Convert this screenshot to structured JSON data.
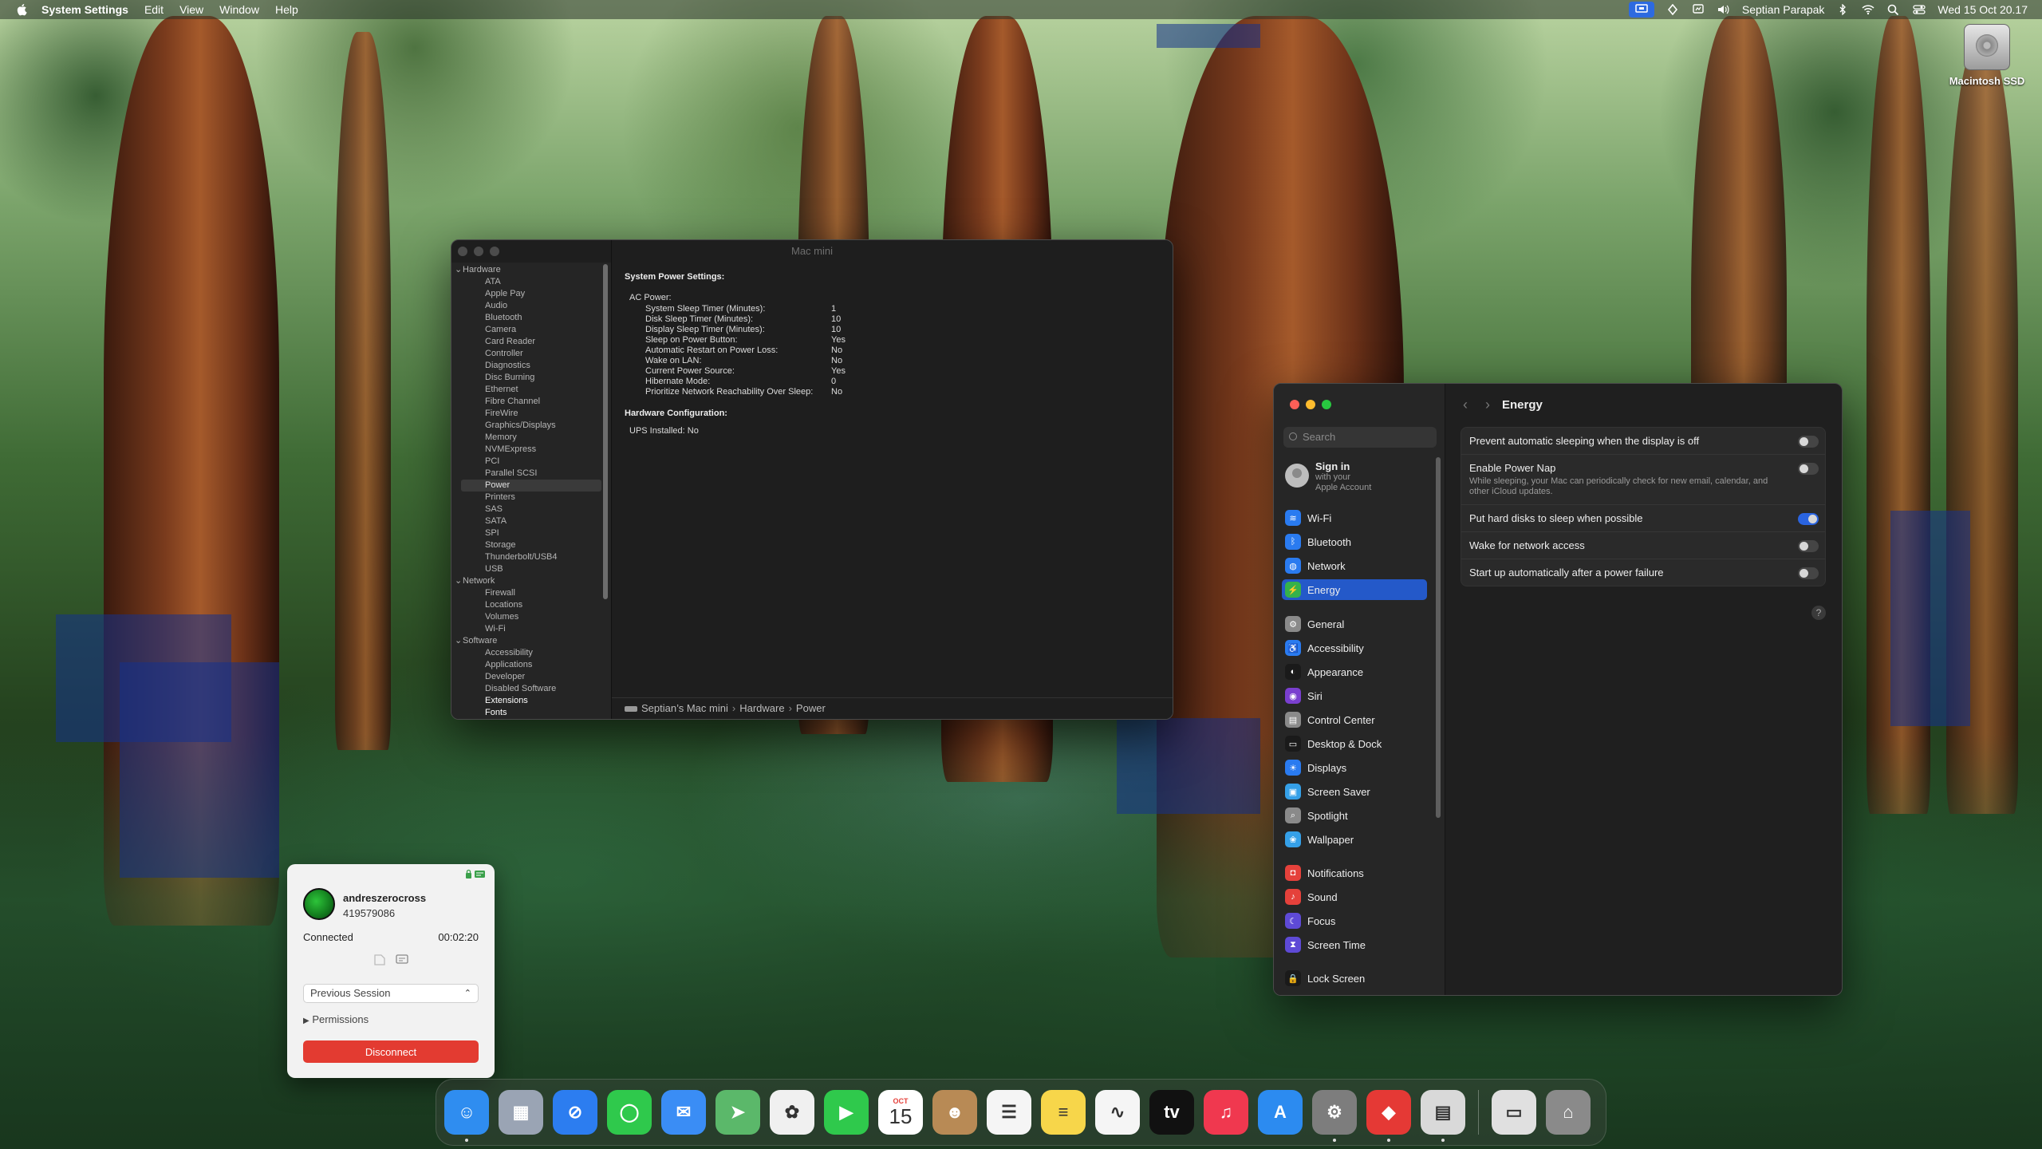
{
  "menubar": {
    "app_name": "System Settings",
    "menus": [
      "Edit",
      "View",
      "Window",
      "Help"
    ],
    "user": "Septian Parapak",
    "clock": "Wed 15 Oct  20.17"
  },
  "desktop": {
    "drive_label": "Macintosh SSD"
  },
  "sysinfo": {
    "title": "Mac mini",
    "sidebar": [
      {
        "label": "Hardware",
        "kind": "group"
      },
      {
        "label": "ATA",
        "kind": "item"
      },
      {
        "label": "Apple Pay",
        "kind": "item"
      },
      {
        "label": "Audio",
        "kind": "item"
      },
      {
        "label": "Bluetooth",
        "kind": "item"
      },
      {
        "label": "Camera",
        "kind": "item"
      },
      {
        "label": "Card Reader",
        "kind": "item"
      },
      {
        "label": "Controller",
        "kind": "item"
      },
      {
        "label": "Diagnostics",
        "kind": "item"
      },
      {
        "label": "Disc Burning",
        "kind": "item"
      },
      {
        "label": "Ethernet",
        "kind": "item"
      },
      {
        "label": "Fibre Channel",
        "kind": "item"
      },
      {
        "label": "FireWire",
        "kind": "item"
      },
      {
        "label": "Graphics/Displays",
        "kind": "item"
      },
      {
        "label": "Memory",
        "kind": "item"
      },
      {
        "label": "NVMExpress",
        "kind": "item"
      },
      {
        "label": "PCI",
        "kind": "item"
      },
      {
        "label": "Parallel SCSI",
        "kind": "item"
      },
      {
        "label": "Power",
        "kind": "item",
        "selected": true
      },
      {
        "label": "Printers",
        "kind": "item"
      },
      {
        "label": "SAS",
        "kind": "item"
      },
      {
        "label": "SATA",
        "kind": "item"
      },
      {
        "label": "SPI",
        "kind": "item"
      },
      {
        "label": "Storage",
        "kind": "item"
      },
      {
        "label": "Thunderbolt/USB4",
        "kind": "item"
      },
      {
        "label": "USB",
        "kind": "item"
      },
      {
        "label": "Network",
        "kind": "group"
      },
      {
        "label": "Firewall",
        "kind": "item"
      },
      {
        "label": "Locations",
        "kind": "item"
      },
      {
        "label": "Volumes",
        "kind": "item"
      },
      {
        "label": "Wi-Fi",
        "kind": "item"
      },
      {
        "label": "Software",
        "kind": "group"
      },
      {
        "label": "Accessibility",
        "kind": "item"
      },
      {
        "label": "Applications",
        "kind": "item"
      },
      {
        "label": "Developer",
        "kind": "item"
      },
      {
        "label": "Disabled Software",
        "kind": "item"
      },
      {
        "label": "Extensions",
        "kind": "item",
        "bold": true
      },
      {
        "label": "Fonts",
        "kind": "item",
        "bold": true
      }
    ],
    "content": {
      "heading": "System Power Settings:",
      "ac_label": "AC Power:",
      "settings": [
        {
          "key": "System Sleep Timer (Minutes):",
          "value": "1"
        },
        {
          "key": "Disk Sleep Timer (Minutes):",
          "value": "10"
        },
        {
          "key": "Display Sleep Timer (Minutes):",
          "value": "10"
        },
        {
          "key": "Sleep on Power Button:",
          "value": "Yes"
        },
        {
          "key": "Automatic Restart on Power Loss:",
          "value": "No"
        },
        {
          "key": "Wake on LAN:",
          "value": "No"
        },
        {
          "key": "Current Power Source:",
          "value": "Yes"
        },
        {
          "key": "Hibernate Mode:",
          "value": "0"
        },
        {
          "key": "Prioritize Network Reachability Over Sleep:",
          "value": "No"
        }
      ],
      "hw_heading": "Hardware Configuration:",
      "ups": "UPS Installed:  No"
    },
    "path": [
      "Septian’s Mac mini",
      "Hardware",
      "Power"
    ]
  },
  "settings": {
    "search_placeholder": "Search",
    "signin_title": "Sign in",
    "signin_sub1": "with your",
    "signin_sub2": "Apple Account",
    "nav": [
      {
        "label": "Wi-Fi",
        "color": "#2a7bf0",
        "glyph": "≋"
      },
      {
        "label": "Bluetooth",
        "color": "#2a7bf0",
        "glyph": "ᛒ"
      },
      {
        "label": "Network",
        "color": "#2a7bf0",
        "glyph": "◍"
      },
      {
        "label": "Energy",
        "color": "#35b14b",
        "glyph": "⚡",
        "selected": true
      },
      {
        "label": "General",
        "color": "#8a8a8a",
        "glyph": "⚙"
      },
      {
        "label": "Accessibility",
        "color": "#2a7bf0",
        "glyph": "♿"
      },
      {
        "label": "Appearance",
        "color": "#1a1a1a",
        "glyph": "◐"
      },
      {
        "label": "Siri",
        "color": "#7a3fcf",
        "glyph": "◉"
      },
      {
        "label": "Control Center",
        "color": "#8a8a8a",
        "glyph": "▤"
      },
      {
        "label": "Desktop & Dock",
        "color": "#1a1a1a",
        "glyph": "▭"
      },
      {
        "label": "Displays",
        "color": "#2a7bf0",
        "glyph": "☀"
      },
      {
        "label": "Screen Saver",
        "color": "#35a0e8",
        "glyph": "▣"
      },
      {
        "label": "Spotlight",
        "color": "#8a8a8a",
        "glyph": "⌕"
      },
      {
        "label": "Wallpaper",
        "color": "#35a0e8",
        "glyph": "❀"
      },
      {
        "label": "Notifications",
        "color": "#e5413b",
        "glyph": "◘"
      },
      {
        "label": "Sound",
        "color": "#e5413b",
        "glyph": "♪"
      },
      {
        "label": "Focus",
        "color": "#5e4ad6",
        "glyph": "☾"
      },
      {
        "label": "Screen Time",
        "color": "#5e4ad6",
        "glyph": "⧗"
      },
      {
        "label": "Lock Screen",
        "color": "#1a1a1a",
        "glyph": "🔒"
      }
    ],
    "header_title": "Energy",
    "rows": [
      {
        "label": "Prevent automatic sleeping when the display is off",
        "on": false
      },
      {
        "label": "Enable Power Nap",
        "desc": "While sleeping, your Mac can periodically check for new email, calendar, and other iCloud updates.",
        "on": false
      },
      {
        "label": "Put hard disks to sleep when possible",
        "on": true
      },
      {
        "label": "Wake for network access",
        "on": false
      },
      {
        "label": "Start up automatically after a power failure",
        "on": false
      }
    ],
    "help_label": "?"
  },
  "remote": {
    "username": "andreszerocross",
    "user_id": "419579086",
    "status": "Connected",
    "timer": "00:02:20",
    "session_select": "Previous Session",
    "permissions": "Permissions",
    "disconnect": "Disconnect"
  },
  "dock": {
    "apps": [
      {
        "name": "finder",
        "color": "#2f8df0",
        "glyph": "☺"
      },
      {
        "name": "launchpad",
        "color": "#9aa4b4",
        "glyph": "▦"
      },
      {
        "name": "safari",
        "color": "#2c7df0",
        "glyph": "⊘"
      },
      {
        "name": "messages",
        "color": "#2fc94c",
        "glyph": "◯"
      },
      {
        "name": "mail",
        "color": "#3a8df5",
        "glyph": "✉"
      },
      {
        "name": "maps",
        "color": "#5bb86a",
        "glyph": "➤"
      },
      {
        "name": "photos",
        "color": "#f0f0f0",
        "glyph": "✿"
      },
      {
        "name": "facetime",
        "color": "#2fc94c",
        "glyph": "▶"
      },
      {
        "name": "calendar",
        "color": "#ffffff",
        "glyph": "15",
        "month": "OCT"
      },
      {
        "name": "contacts",
        "color": "#b88a55",
        "glyph": "☻"
      },
      {
        "name": "reminders",
        "color": "#f5f5f5",
        "glyph": "☰"
      },
      {
        "name": "notes",
        "color": "#f7d64a",
        "glyph": "≡"
      },
      {
        "name": "freeform",
        "color": "#f5f5f5",
        "glyph": "∿"
      },
      {
        "name": "tv",
        "color": "#111111",
        "glyph": "tv"
      },
      {
        "name": "music",
        "color": "#f0384f",
        "glyph": "♫"
      },
      {
        "name": "app-store",
        "color": "#2c8bf0",
        "glyph": "A"
      },
      {
        "name": "system-settings",
        "color": "#7d7d7d",
        "glyph": "⚙"
      },
      {
        "name": "anydesk",
        "color": "#e53935",
        "glyph": "◆"
      },
      {
        "name": "preview",
        "color": "#d9d9d9",
        "glyph": "▤"
      },
      {
        "name": "separator"
      },
      {
        "name": "document",
        "color": "#e0e0e0",
        "glyph": "▭"
      },
      {
        "name": "trash",
        "color": "#8a8a8a",
        "glyph": "⌂"
      }
    ]
  }
}
